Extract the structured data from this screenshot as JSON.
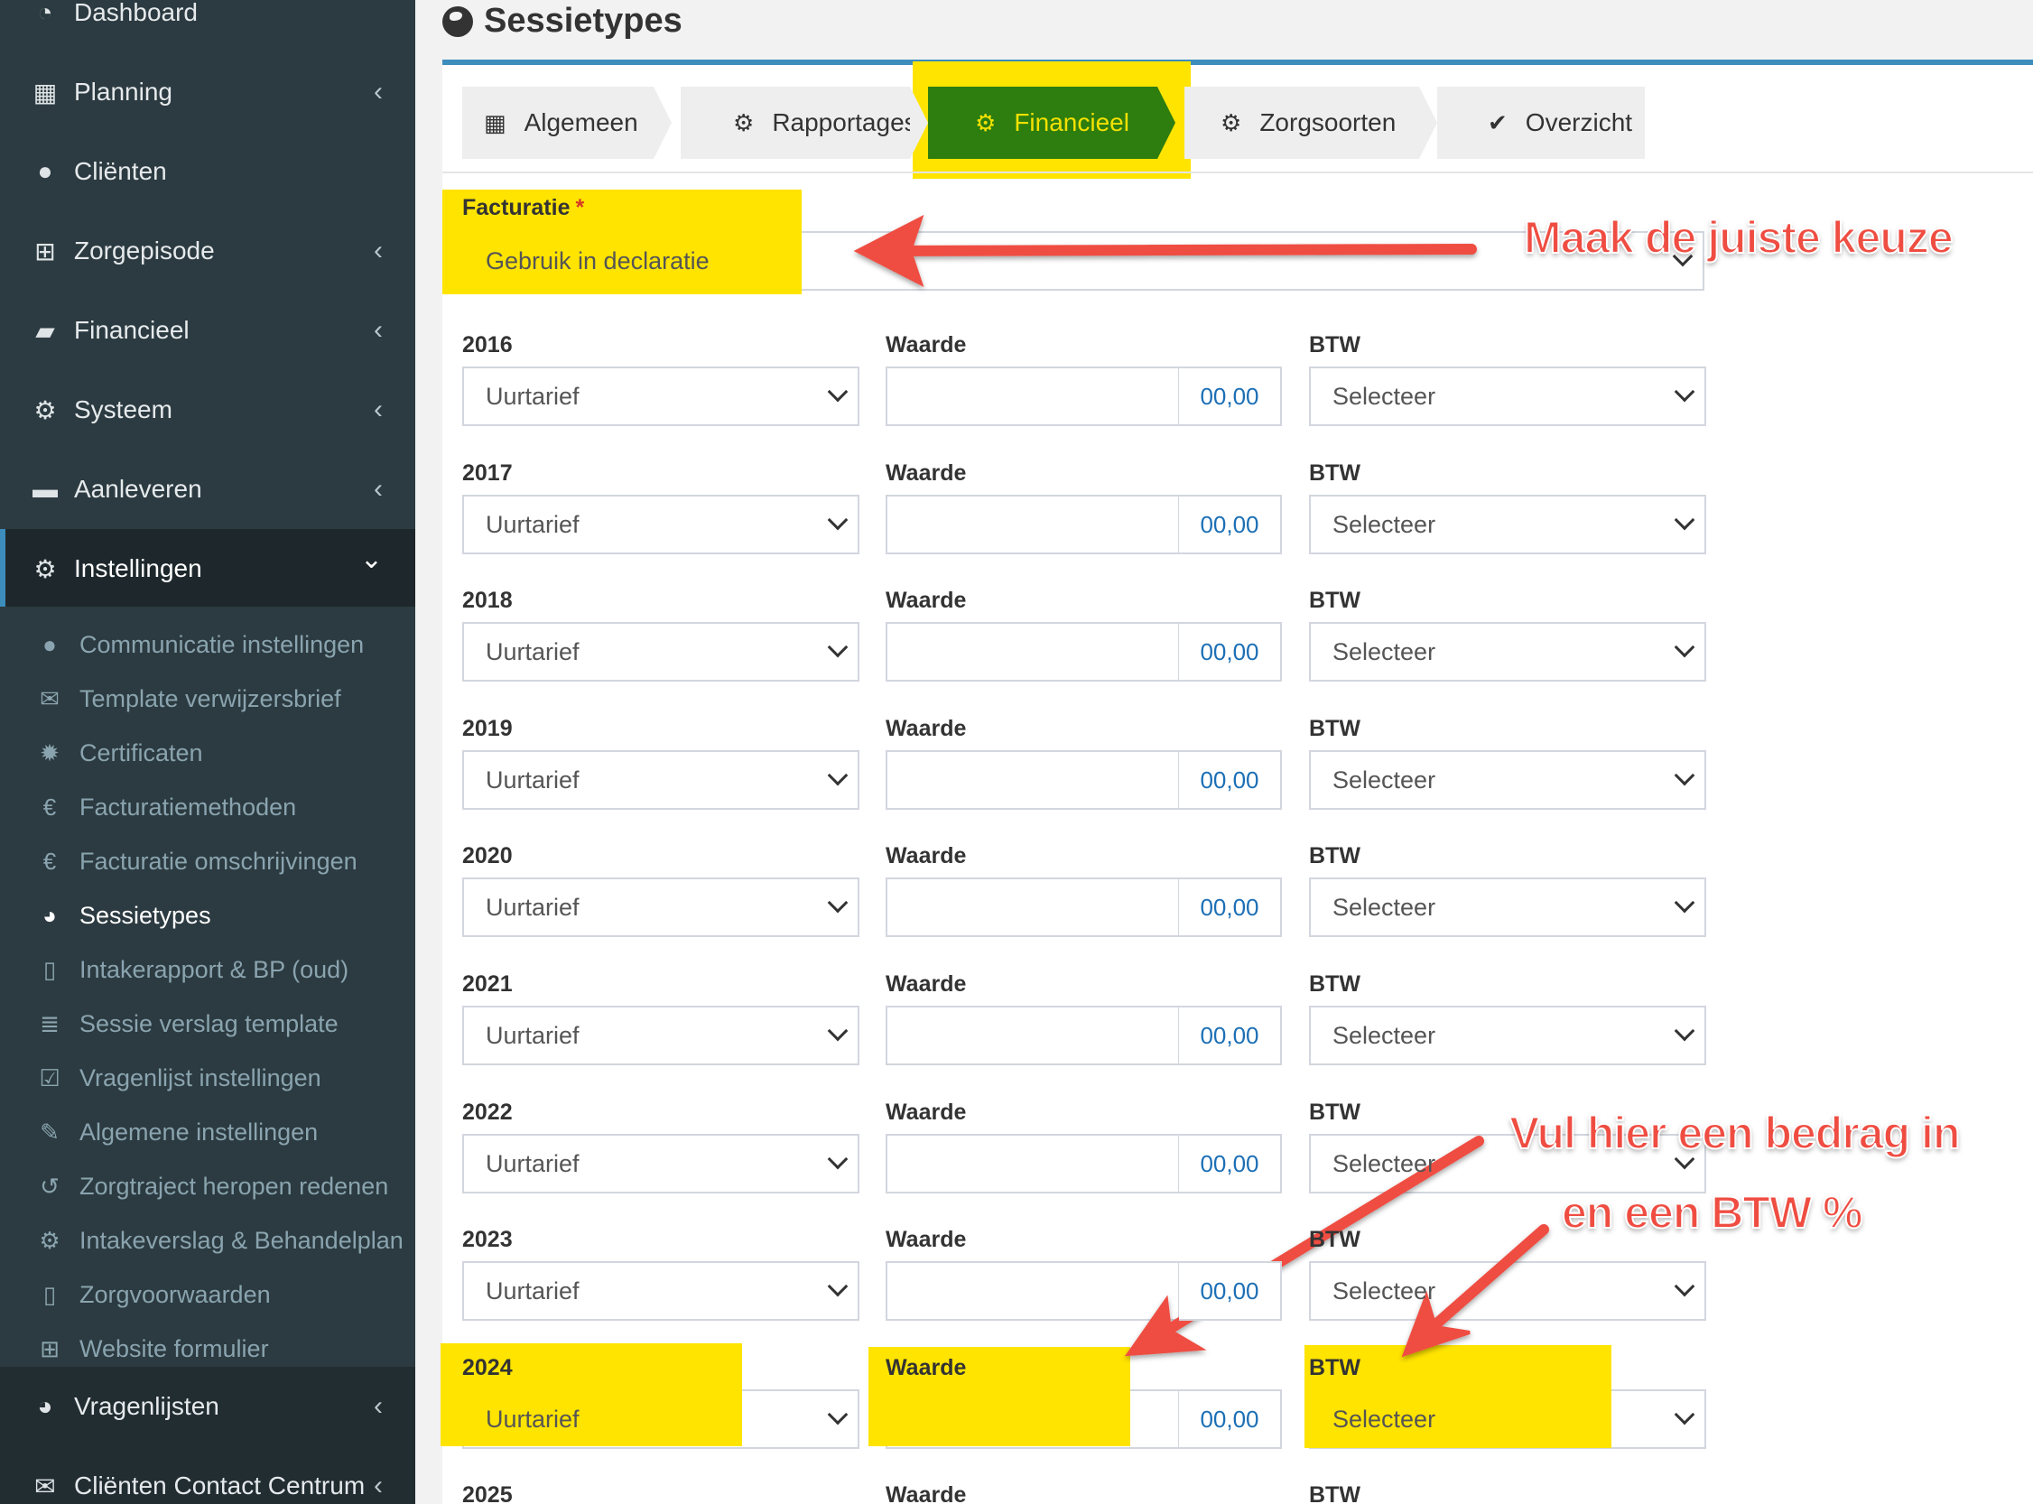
{
  "sidebar": {
    "items": [
      {
        "label": "Dashboard",
        "icon": "dashboard-icon",
        "chevron": ""
      },
      {
        "label": "Planning",
        "icon": "calendar-icon",
        "chevron": "‹"
      },
      {
        "label": "Cliënten",
        "icon": "user-icon",
        "chevron": ""
      },
      {
        "label": "Zorgepisode",
        "icon": "medkit-icon",
        "chevron": "‹"
      },
      {
        "label": "Financieel",
        "icon": "book-icon",
        "chevron": "‹"
      },
      {
        "label": "Systeem",
        "icon": "cogs-icon",
        "chevron": "‹"
      },
      {
        "label": "Aanleveren",
        "icon": "truck-icon",
        "chevron": "‹"
      },
      {
        "label": "Instellingen",
        "icon": "gear-icon",
        "chevron": "⌄"
      }
    ],
    "submenu": [
      {
        "label": "Communicatie instellingen",
        "icon": "comments-icon"
      },
      {
        "label": "Template verwijzersbrief",
        "icon": "envelope-icon"
      },
      {
        "label": "Certificaten",
        "icon": "certificate-icon"
      },
      {
        "label": "Facturatiemethoden",
        "icon": "euro-icon"
      },
      {
        "label": "Facturatie omschrijvingen",
        "icon": "euro-icon"
      },
      {
        "label": "Sessietypes",
        "icon": "globe-icon"
      },
      {
        "label": "Intakerapport & BP (oud)",
        "icon": "file-icon"
      },
      {
        "label": "Sessie verslag template",
        "icon": "list-icon"
      },
      {
        "label": "Vragenlijst instellingen",
        "icon": "checkbox-icon"
      },
      {
        "label": "Algemene instellingen",
        "icon": "wrench-icon"
      },
      {
        "label": "Zorgtraject heropen redenen",
        "icon": "undo-icon"
      },
      {
        "label": "Intakeverslag & Behandelplan",
        "icon": "gear-icon"
      },
      {
        "label": "Zorgvoorwaarden",
        "icon": "pdf-file-icon"
      },
      {
        "label": "Website formulier",
        "icon": "medkit-icon"
      }
    ],
    "bottom": [
      {
        "label": "Vragenlijsten",
        "icon": "globe-icon",
        "chevron": "‹"
      },
      {
        "label": "Cliënten Contact Centrum",
        "icon": "envelope-icon",
        "chevron": "‹"
      }
    ]
  },
  "page": {
    "title": "Sessietypes"
  },
  "tabs": [
    {
      "label": "Algemeen",
      "icon": "table-icon"
    },
    {
      "label": "Rapportages",
      "icon": "gear-icon"
    },
    {
      "label": "Financieel",
      "icon": "gear-icon"
    },
    {
      "label": "Zorgsoorten",
      "icon": "gear-icon"
    },
    {
      "label": "Overzicht",
      "icon": "check-icon"
    }
  ],
  "facturatie": {
    "label": "Facturatie",
    "required_mark": "*",
    "value": "Gebruik in declaratie"
  },
  "rows": [
    {
      "year": "2016",
      "tariff": "Uurtarief",
      "waarde_label": "Waarde",
      "waarde": "",
      "addon": "00,00",
      "btw_label": "BTW",
      "btw": "Selecteer"
    },
    {
      "year": "2017",
      "tariff": "Uurtarief",
      "waarde_label": "Waarde",
      "waarde": "",
      "addon": "00,00",
      "btw_label": "BTW",
      "btw": "Selecteer"
    },
    {
      "year": "2018",
      "tariff": "Uurtarief",
      "waarde_label": "Waarde",
      "waarde": "",
      "addon": "00,00",
      "btw_label": "BTW",
      "btw": "Selecteer"
    },
    {
      "year": "2019",
      "tariff": "Uurtarief",
      "waarde_label": "Waarde",
      "waarde": "",
      "addon": "00,00",
      "btw_label": "BTW",
      "btw": "Selecteer"
    },
    {
      "year": "2020",
      "tariff": "Uurtarief",
      "waarde_label": "Waarde",
      "waarde": "",
      "addon": "00,00",
      "btw_label": "BTW",
      "btw": "Selecteer"
    },
    {
      "year": "2021",
      "tariff": "Uurtarief",
      "waarde_label": "Waarde",
      "waarde": "",
      "addon": "00,00",
      "btw_label": "BTW",
      "btw": "Selecteer"
    },
    {
      "year": "2022",
      "tariff": "Uurtarief",
      "waarde_label": "Waarde",
      "waarde": "",
      "addon": "00,00",
      "btw_label": "BTW",
      "btw": "Selecteer"
    },
    {
      "year": "2023",
      "tariff": "Uurtarief",
      "waarde_label": "Waarde",
      "waarde": "",
      "addon": "00,00",
      "btw_label": "BTW",
      "btw": "Selecteer"
    },
    {
      "year": "2024",
      "tariff": "Uurtarief",
      "waarde_label": "Waarde",
      "waarde": "",
      "addon": "00,00",
      "btw_label": "BTW",
      "btw": "Selecteer"
    },
    {
      "year": "2025",
      "tariff": "",
      "waarde_label": "Waarde",
      "waarde": "",
      "addon": "",
      "btw_label": "BTW",
      "btw": ""
    }
  ],
  "annotations": {
    "keuze": "Maak de juiste keuze",
    "bedrag_line1": "Vul hier een bedrag in",
    "bedrag_line2": "en een BTW %"
  },
  "colors": {
    "sidebar_bg": "#2c3b41",
    "accent": "#3c8dbc",
    "active_tab": "#2e7d0f",
    "highlight": "#ffe400",
    "annotation": "#ef4d42"
  }
}
